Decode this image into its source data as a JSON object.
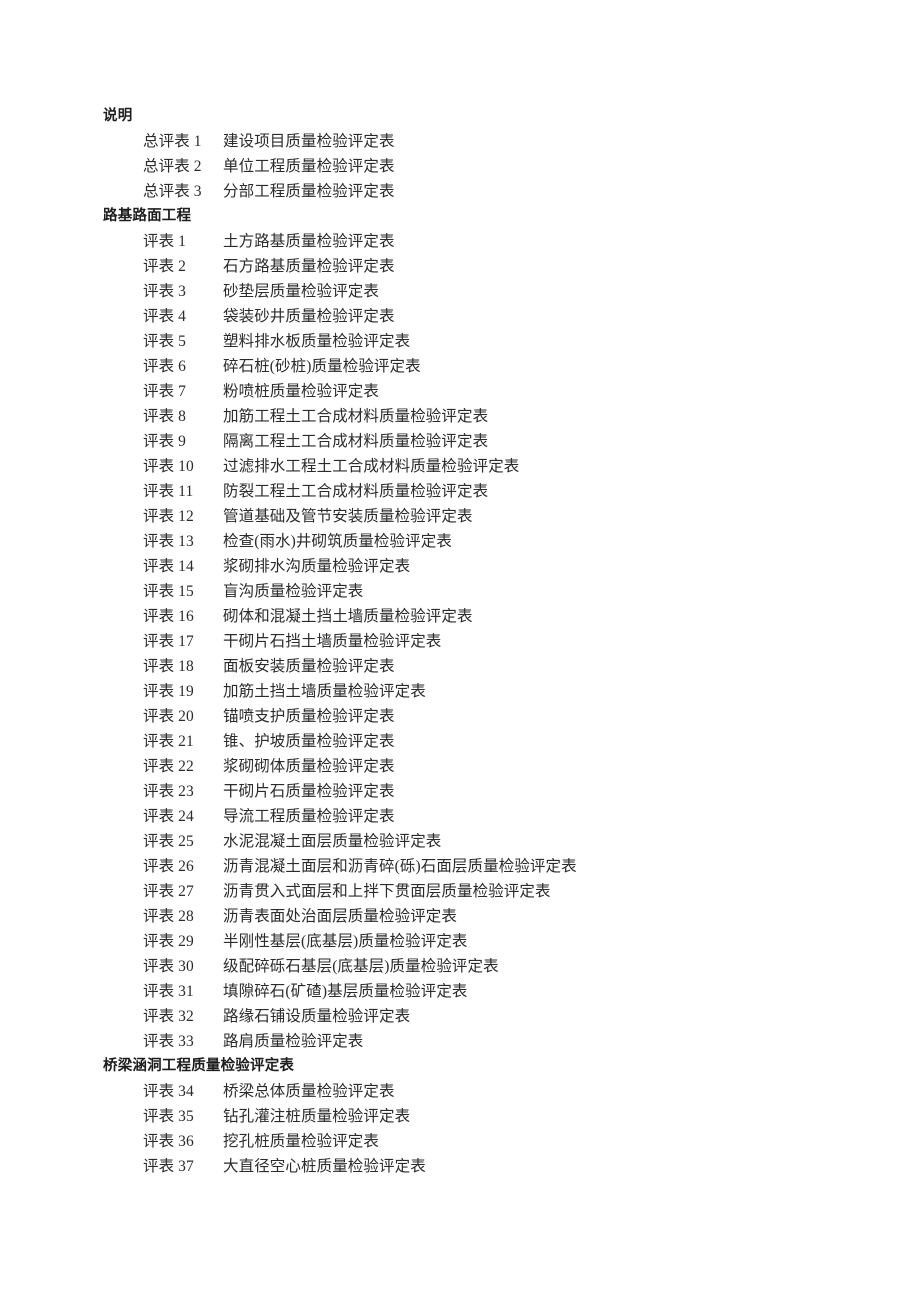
{
  "document": {
    "background_color": "#ffffff",
    "text_color": "#2b2b2b",
    "heading_color": "#1d1d1d"
  },
  "sections": [
    {
      "heading": "说明",
      "entries": [
        {
          "label": "总评表 1",
          "title": "建设项目质量检验评定表"
        },
        {
          "label": "总评表 2",
          "title": "单位工程质量检验评定表"
        },
        {
          "label": "总评表 3",
          "title": "分部工程质量检验评定表"
        }
      ]
    },
    {
      "heading": "路基路面工程",
      "entries": [
        {
          "label": "评表 1",
          "title": "土方路基质量检验评定表"
        },
        {
          "label": "评表 2",
          "title": "石方路基质量检验评定表"
        },
        {
          "label": "评表 3",
          "title": "砂垫层质量检验评定表"
        },
        {
          "label": "评表 4",
          "title": "袋装砂井质量检验评定表"
        },
        {
          "label": "评表 5",
          "title": "塑料排水板质量检验评定表"
        },
        {
          "label": "评表 6",
          "title": "碎石桩(砂桩)质量检验评定表"
        },
        {
          "label": "评表 7",
          "title": "粉喷桩质量检验评定表"
        },
        {
          "label": "评表 8",
          "title": "加筋工程土工合成材料质量检验评定表"
        },
        {
          "label": "评表 9",
          "title": "隔离工程土工合成材料质量检验评定表"
        },
        {
          "label": "评表 10",
          "title": "过滤排水工程土工合成材料质量检验评定表"
        },
        {
          "label": "评表 11",
          "title": "防裂工程土工合成材料质量检验评定表"
        },
        {
          "label": "评表 12",
          "title": "管道基础及管节安装质量检验评定表"
        },
        {
          "label": "评表 13",
          "title": "检查(雨水)井砌筑质量检验评定表"
        },
        {
          "label": "评表 14",
          "title": "浆砌排水沟质量检验评定表"
        },
        {
          "label": "评表 15",
          "title": "盲沟质量检验评定表"
        },
        {
          "label": "评表 16",
          "title": "砌体和混凝土挡土墙质量检验评定表"
        },
        {
          "label": "评表 17",
          "title": "干砌片石挡土墙质量检验评定表"
        },
        {
          "label": "评表 18",
          "title": "面板安装质量检验评定表"
        },
        {
          "label": "评表 19",
          "title": "加筋土挡土墙质量检验评定表"
        },
        {
          "label": "评表 20",
          "title": "锚喷支护质量检验评定表"
        },
        {
          "label": "评表 21",
          "title": "锥、护坡质量检验评定表"
        },
        {
          "label": "评表 22",
          "title": "浆砌砌体质量检验评定表"
        },
        {
          "label": "评表 23",
          "title": "干砌片石质量检验评定表"
        },
        {
          "label": "评表 24",
          "title": "导流工程质量检验评定表"
        },
        {
          "label": "评表 25",
          "title": "水泥混凝土面层质量检验评定表"
        },
        {
          "label": "评表 26",
          "title": "沥青混凝土面层和沥青碎(砾)石面层质量检验评定表"
        },
        {
          "label": "评表 27",
          "title": "沥青贯入式面层和上拌下贯面层质量检验评定表"
        },
        {
          "label": "评表 28",
          "title": "沥青表面处治面层质量检验评定表"
        },
        {
          "label": "评表 29",
          "title": "半刚性基层(底基层)质量检验评定表"
        },
        {
          "label": "评表 30",
          "title": "级配碎砾石基层(底基层)质量检验评定表"
        },
        {
          "label": "评表 31",
          "title": "填隙碎石(矿碴)基层质量检验评定表"
        },
        {
          "label": "评表 32",
          "title": "路缘石铺设质量检验评定表"
        },
        {
          "label": "评表 33",
          "title": "路肩质量检验评定表"
        }
      ]
    },
    {
      "heading": "桥梁涵洞工程质量检验评定表",
      "entries": [
        {
          "label": "评表 34",
          "title": "桥梁总体质量检验评定表"
        },
        {
          "label": "评表 35",
          "title": "钻孔灌注桩质量检验评定表"
        },
        {
          "label": "评表 36",
          "title": "挖孔桩质量检验评定表"
        },
        {
          "label": "评表 37",
          "title": "大直径空心桩质量检验评定表"
        }
      ]
    }
  ]
}
